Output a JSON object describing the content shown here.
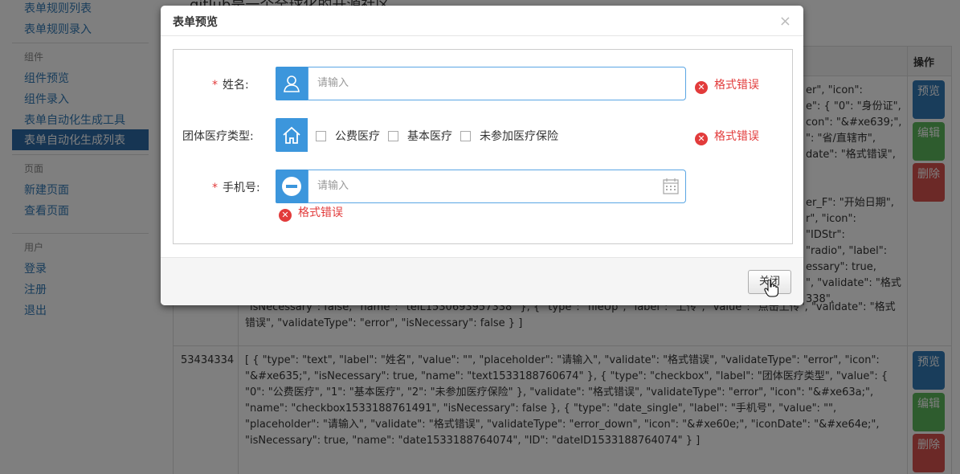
{
  "sidebar": {
    "items_top": [
      "表单规则列表",
      "表单规则录入"
    ],
    "group_components": "组件",
    "items_components": [
      "组件预览",
      "组件录入",
      "表单自动化生成工具",
      "表单自动化生成列表"
    ],
    "group_pages": "页面",
    "items_pages": [
      "新建页面",
      "查看页面"
    ],
    "group_user": "用户",
    "items_user": [
      "登录",
      "注册",
      "退出"
    ]
  },
  "background": {
    "top_text": "gitlub是一个全球化的开源社区",
    "table_header_op": "操作",
    "right_fragments": [
      "er\", \"icon\":",
      "e\": { \"0\": \"身份证\",",
      "con\": \"&#xe639;\",",
      "\": \"省/直辖市\",",
      "date\": \"格式错误\",",
      "er_F\": \"开始日期\",",
      "r\", \"icon\":",
      "\"IDStr\":",
      "\"radio\", \"label\":",
      "essary\": true,",
      "\", \"validate\": \"格式",
      "338\","
    ],
    "row1_tail": "\"isNecessary\": false, \"name\": \"telL1530693957338\" }, { \"type\": \"fileUp\", \"label\": \"上传\", \"value\": \"点击上传\", \"validate\": \"格式错误\", \"validateType\": \"error\", \"isNecessary\": false } ]",
    "row2_id": "53434334",
    "row2_json": "[ { \"type\": \"text\", \"label\": \"姓名\", \"value\": \"\", \"placeholder\": \"请输入\", \"validate\": \"格式错误\", \"validateType\": \"error\", \"icon\": \"&#xe635;\", \"isNecessary\": true, \"name\": \"text1533188760674\" }, { \"type\": \"checkbox\", \"label\": \"团体医疗类型\", \"value\": { \"0\": \"公费医疗\", \"1\": \"基本医疗\", \"2\": \"未参加医疗保险\" }, \"validate\": \"格式错误\", \"validateType\": \"error\", \"icon\": \"&#xe63a;\", \"name\": \"checkbox1533188761491\", \"isNecessary\": false }, { \"type\": \"date_single\", \"label\": \"手机号\", \"value\": \"\", \"placeholder\": \"请输入\", \"validate\": \"格式错误\", \"validateType\": \"error_down\", \"icon\": \"&#xe60e;\", \"iconDate\": \"&#xe64e;\", \"isNecessary\": true, \"name\": \"date1533188764074\", \"ID\": \"dateID1533188764074\" } ]",
    "op_buttons": [
      "预览",
      "编辑",
      "删除"
    ]
  },
  "modal": {
    "title": "表单预览",
    "close_symbol": "×",
    "fields": {
      "name": {
        "required_mark": "*",
        "label": "姓名:",
        "placeholder": "请输入",
        "error": "格式错误"
      },
      "medical": {
        "label": "团体医疗类型:",
        "options": [
          "公费医疗",
          "基本医疗",
          "未参加医疗保险"
        ],
        "error": "格式错误"
      },
      "phone": {
        "required_mark": "*",
        "label": "手机号:",
        "placeholder": "请输入",
        "error": "格式错误"
      }
    },
    "close_button": "关闭"
  },
  "colors": {
    "accent": "#3c96dc",
    "error": "#e23b3b",
    "sidebar_active": "#2c6aa6"
  }
}
